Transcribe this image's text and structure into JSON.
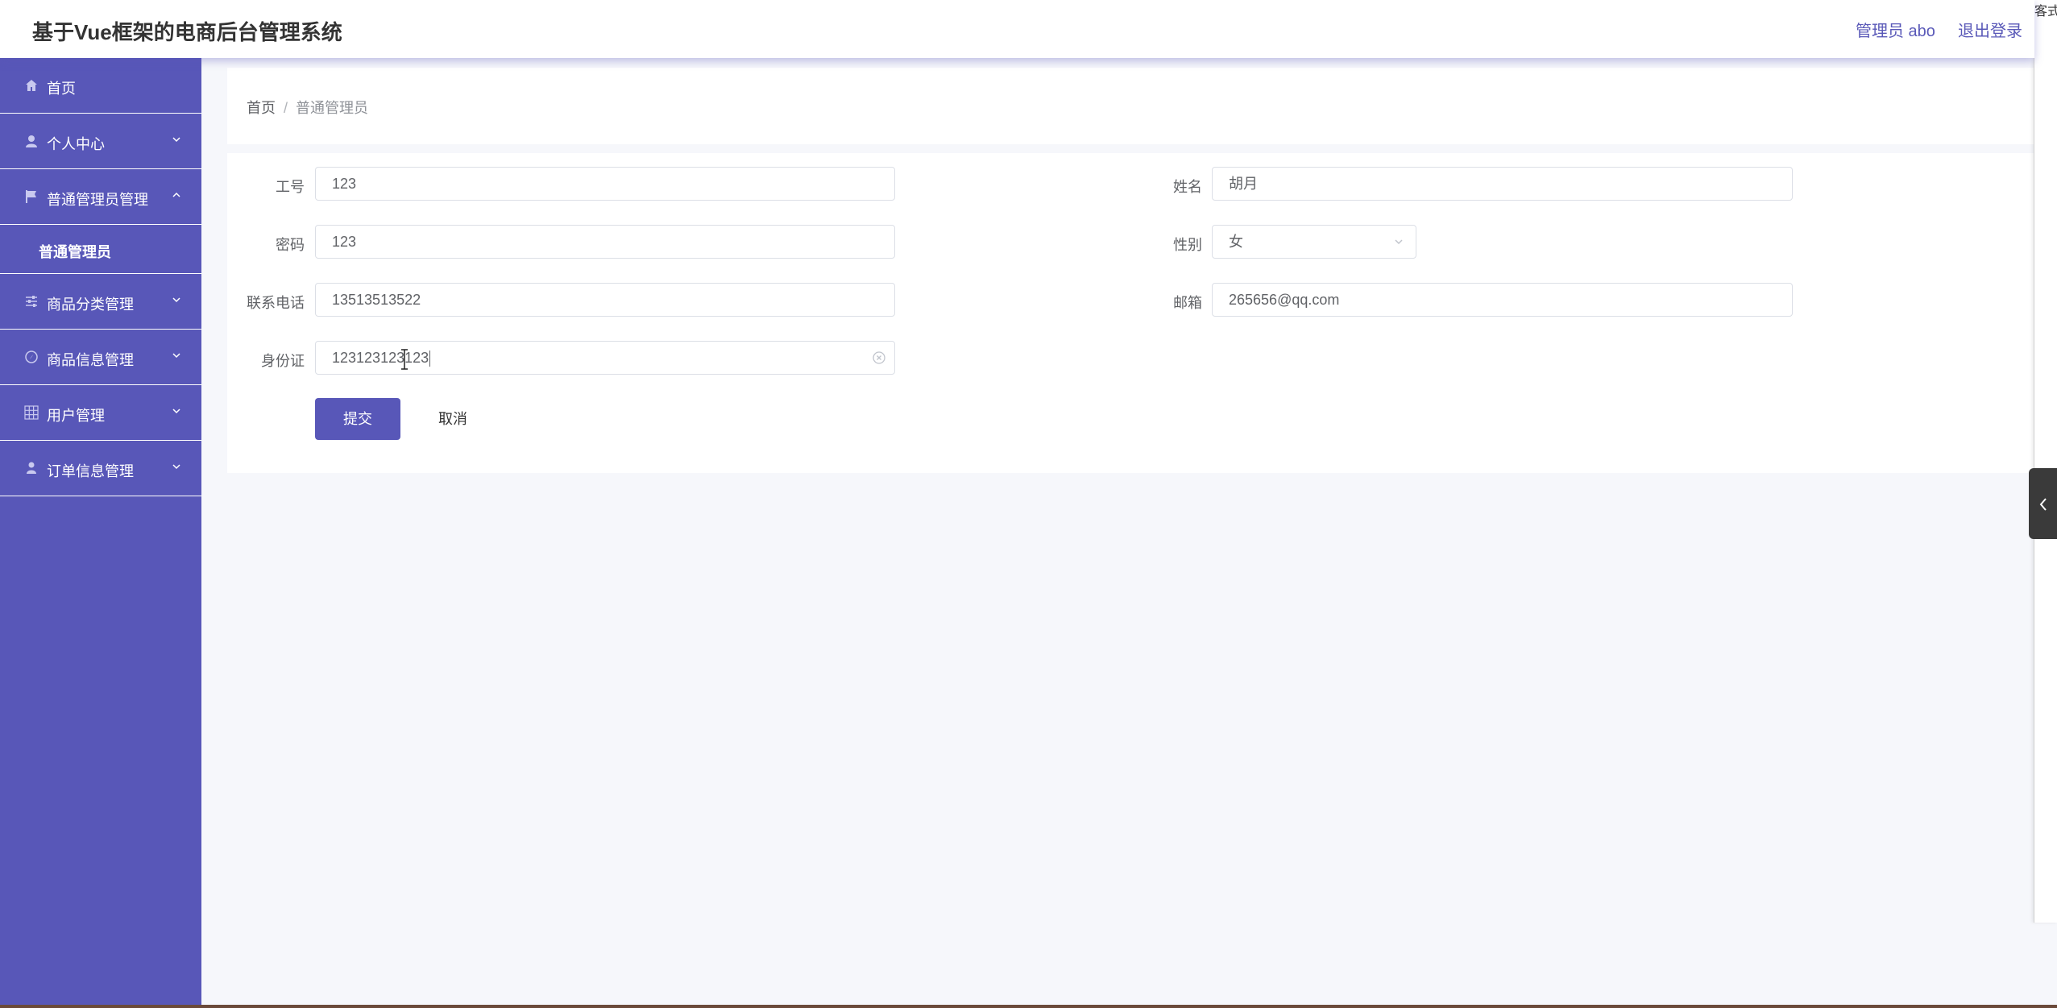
{
  "header": {
    "title": "基于Vue框架的电商后台管理系统",
    "user": "管理员 abo",
    "logout": "退出登录"
  },
  "sidebar": {
    "items": [
      {
        "label": "首页",
        "icon": "home-icon"
      },
      {
        "label": "个人中心",
        "icon": "user-icon"
      },
      {
        "label": "普通管理员管理",
        "icon": "flag-icon"
      },
      {
        "label": "商品分类管理",
        "icon": "sliders-icon"
      },
      {
        "label": "商品信息管理",
        "icon": "compass-icon"
      },
      {
        "label": "用户管理",
        "icon": "grid-icon"
      },
      {
        "label": "订单信息管理",
        "icon": "person-icon"
      }
    ],
    "submenu": {
      "label": "普通管理员"
    }
  },
  "breadcrumb": {
    "home": "首页",
    "separator": "/",
    "current": "普通管理员"
  },
  "form": {
    "fields": {
      "employee_id": {
        "label": "工号",
        "value": "123"
      },
      "name": {
        "label": "姓名",
        "value": "胡月"
      },
      "password": {
        "label": "密码",
        "value": "123"
      },
      "gender": {
        "label": "性别",
        "value": "女"
      },
      "phone": {
        "label": "联系电话",
        "value": "13513513522"
      },
      "email": {
        "label": "邮箱",
        "value": "265656@qq.com"
      },
      "id_card": {
        "label": "身份证",
        "value": "123123123123"
      }
    },
    "submit_label": "提交",
    "cancel_label": "取消"
  },
  "right_panel": {
    "text": "客式"
  },
  "colors": {
    "sidebar": "#5857b8",
    "primary_button": "#5857b8",
    "page_background": "#f6f7fb",
    "header_text": "#5a59b8"
  }
}
